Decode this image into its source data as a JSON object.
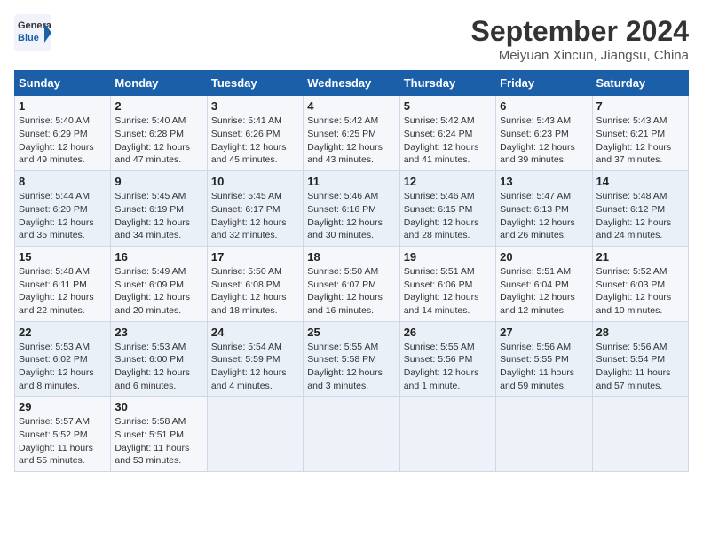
{
  "logo": {
    "line1": "General",
    "line2": "Blue"
  },
  "title": "September 2024",
  "subtitle": "Meiyuan Xincun, Jiangsu, China",
  "days_of_week": [
    "Sunday",
    "Monday",
    "Tuesday",
    "Wednesday",
    "Thursday",
    "Friday",
    "Saturday"
  ],
  "weeks": [
    [
      {
        "day": "1",
        "info": "Sunrise: 5:40 AM\nSunset: 6:29 PM\nDaylight: 12 hours\nand 49 minutes."
      },
      {
        "day": "2",
        "info": "Sunrise: 5:40 AM\nSunset: 6:28 PM\nDaylight: 12 hours\nand 47 minutes."
      },
      {
        "day": "3",
        "info": "Sunrise: 5:41 AM\nSunset: 6:26 PM\nDaylight: 12 hours\nand 45 minutes."
      },
      {
        "day": "4",
        "info": "Sunrise: 5:42 AM\nSunset: 6:25 PM\nDaylight: 12 hours\nand 43 minutes."
      },
      {
        "day": "5",
        "info": "Sunrise: 5:42 AM\nSunset: 6:24 PM\nDaylight: 12 hours\nand 41 minutes."
      },
      {
        "day": "6",
        "info": "Sunrise: 5:43 AM\nSunset: 6:23 PM\nDaylight: 12 hours\nand 39 minutes."
      },
      {
        "day": "7",
        "info": "Sunrise: 5:43 AM\nSunset: 6:21 PM\nDaylight: 12 hours\nand 37 minutes."
      }
    ],
    [
      {
        "day": "8",
        "info": "Sunrise: 5:44 AM\nSunset: 6:20 PM\nDaylight: 12 hours\nand 35 minutes."
      },
      {
        "day": "9",
        "info": "Sunrise: 5:45 AM\nSunset: 6:19 PM\nDaylight: 12 hours\nand 34 minutes."
      },
      {
        "day": "10",
        "info": "Sunrise: 5:45 AM\nSunset: 6:17 PM\nDaylight: 12 hours\nand 32 minutes."
      },
      {
        "day": "11",
        "info": "Sunrise: 5:46 AM\nSunset: 6:16 PM\nDaylight: 12 hours\nand 30 minutes."
      },
      {
        "day": "12",
        "info": "Sunrise: 5:46 AM\nSunset: 6:15 PM\nDaylight: 12 hours\nand 28 minutes."
      },
      {
        "day": "13",
        "info": "Sunrise: 5:47 AM\nSunset: 6:13 PM\nDaylight: 12 hours\nand 26 minutes."
      },
      {
        "day": "14",
        "info": "Sunrise: 5:48 AM\nSunset: 6:12 PM\nDaylight: 12 hours\nand 24 minutes."
      }
    ],
    [
      {
        "day": "15",
        "info": "Sunrise: 5:48 AM\nSunset: 6:11 PM\nDaylight: 12 hours\nand 22 minutes."
      },
      {
        "day": "16",
        "info": "Sunrise: 5:49 AM\nSunset: 6:09 PM\nDaylight: 12 hours\nand 20 minutes."
      },
      {
        "day": "17",
        "info": "Sunrise: 5:50 AM\nSunset: 6:08 PM\nDaylight: 12 hours\nand 18 minutes."
      },
      {
        "day": "18",
        "info": "Sunrise: 5:50 AM\nSunset: 6:07 PM\nDaylight: 12 hours\nand 16 minutes."
      },
      {
        "day": "19",
        "info": "Sunrise: 5:51 AM\nSunset: 6:06 PM\nDaylight: 12 hours\nand 14 minutes."
      },
      {
        "day": "20",
        "info": "Sunrise: 5:51 AM\nSunset: 6:04 PM\nDaylight: 12 hours\nand 12 minutes."
      },
      {
        "day": "21",
        "info": "Sunrise: 5:52 AM\nSunset: 6:03 PM\nDaylight: 12 hours\nand 10 minutes."
      }
    ],
    [
      {
        "day": "22",
        "info": "Sunrise: 5:53 AM\nSunset: 6:02 PM\nDaylight: 12 hours\nand 8 minutes."
      },
      {
        "day": "23",
        "info": "Sunrise: 5:53 AM\nSunset: 6:00 PM\nDaylight: 12 hours\nand 6 minutes."
      },
      {
        "day": "24",
        "info": "Sunrise: 5:54 AM\nSunset: 5:59 PM\nDaylight: 12 hours\nand 4 minutes."
      },
      {
        "day": "25",
        "info": "Sunrise: 5:55 AM\nSunset: 5:58 PM\nDaylight: 12 hours\nand 3 minutes."
      },
      {
        "day": "26",
        "info": "Sunrise: 5:55 AM\nSunset: 5:56 PM\nDaylight: 12 hours\nand 1 minute."
      },
      {
        "day": "27",
        "info": "Sunrise: 5:56 AM\nSunset: 5:55 PM\nDaylight: 11 hours\nand 59 minutes."
      },
      {
        "day": "28",
        "info": "Sunrise: 5:56 AM\nSunset: 5:54 PM\nDaylight: 11 hours\nand 57 minutes."
      }
    ],
    [
      {
        "day": "29",
        "info": "Sunrise: 5:57 AM\nSunset: 5:52 PM\nDaylight: 11 hours\nand 55 minutes."
      },
      {
        "day": "30",
        "info": "Sunrise: 5:58 AM\nSunset: 5:51 PM\nDaylight: 11 hours\nand 53 minutes."
      },
      {
        "day": "",
        "info": ""
      },
      {
        "day": "",
        "info": ""
      },
      {
        "day": "",
        "info": ""
      },
      {
        "day": "",
        "info": ""
      },
      {
        "day": "",
        "info": ""
      }
    ]
  ]
}
